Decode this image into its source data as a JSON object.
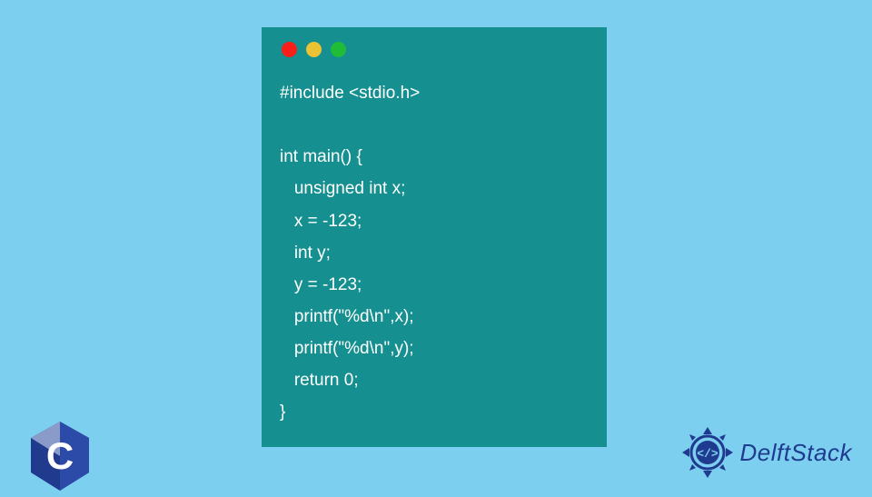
{
  "code": {
    "lines": [
      "#include <stdio.h>",
      "",
      "int main() {",
      "   unsigned int x;",
      "   x = -123;",
      "   int y;",
      "   y = -123;",
      "   printf(\"%d\\n\",x);",
      "   printf(\"%d\\n\",y);",
      "   return 0;",
      "}"
    ]
  },
  "branding": {
    "c_logo_letter": "C",
    "site_name": "DelftStack"
  },
  "colors": {
    "background": "#7dcff0",
    "code_window": "#158f8f",
    "code_text": "#ffffff",
    "c_logo": "#203a8e",
    "delft_blue": "#1f3b8f"
  }
}
